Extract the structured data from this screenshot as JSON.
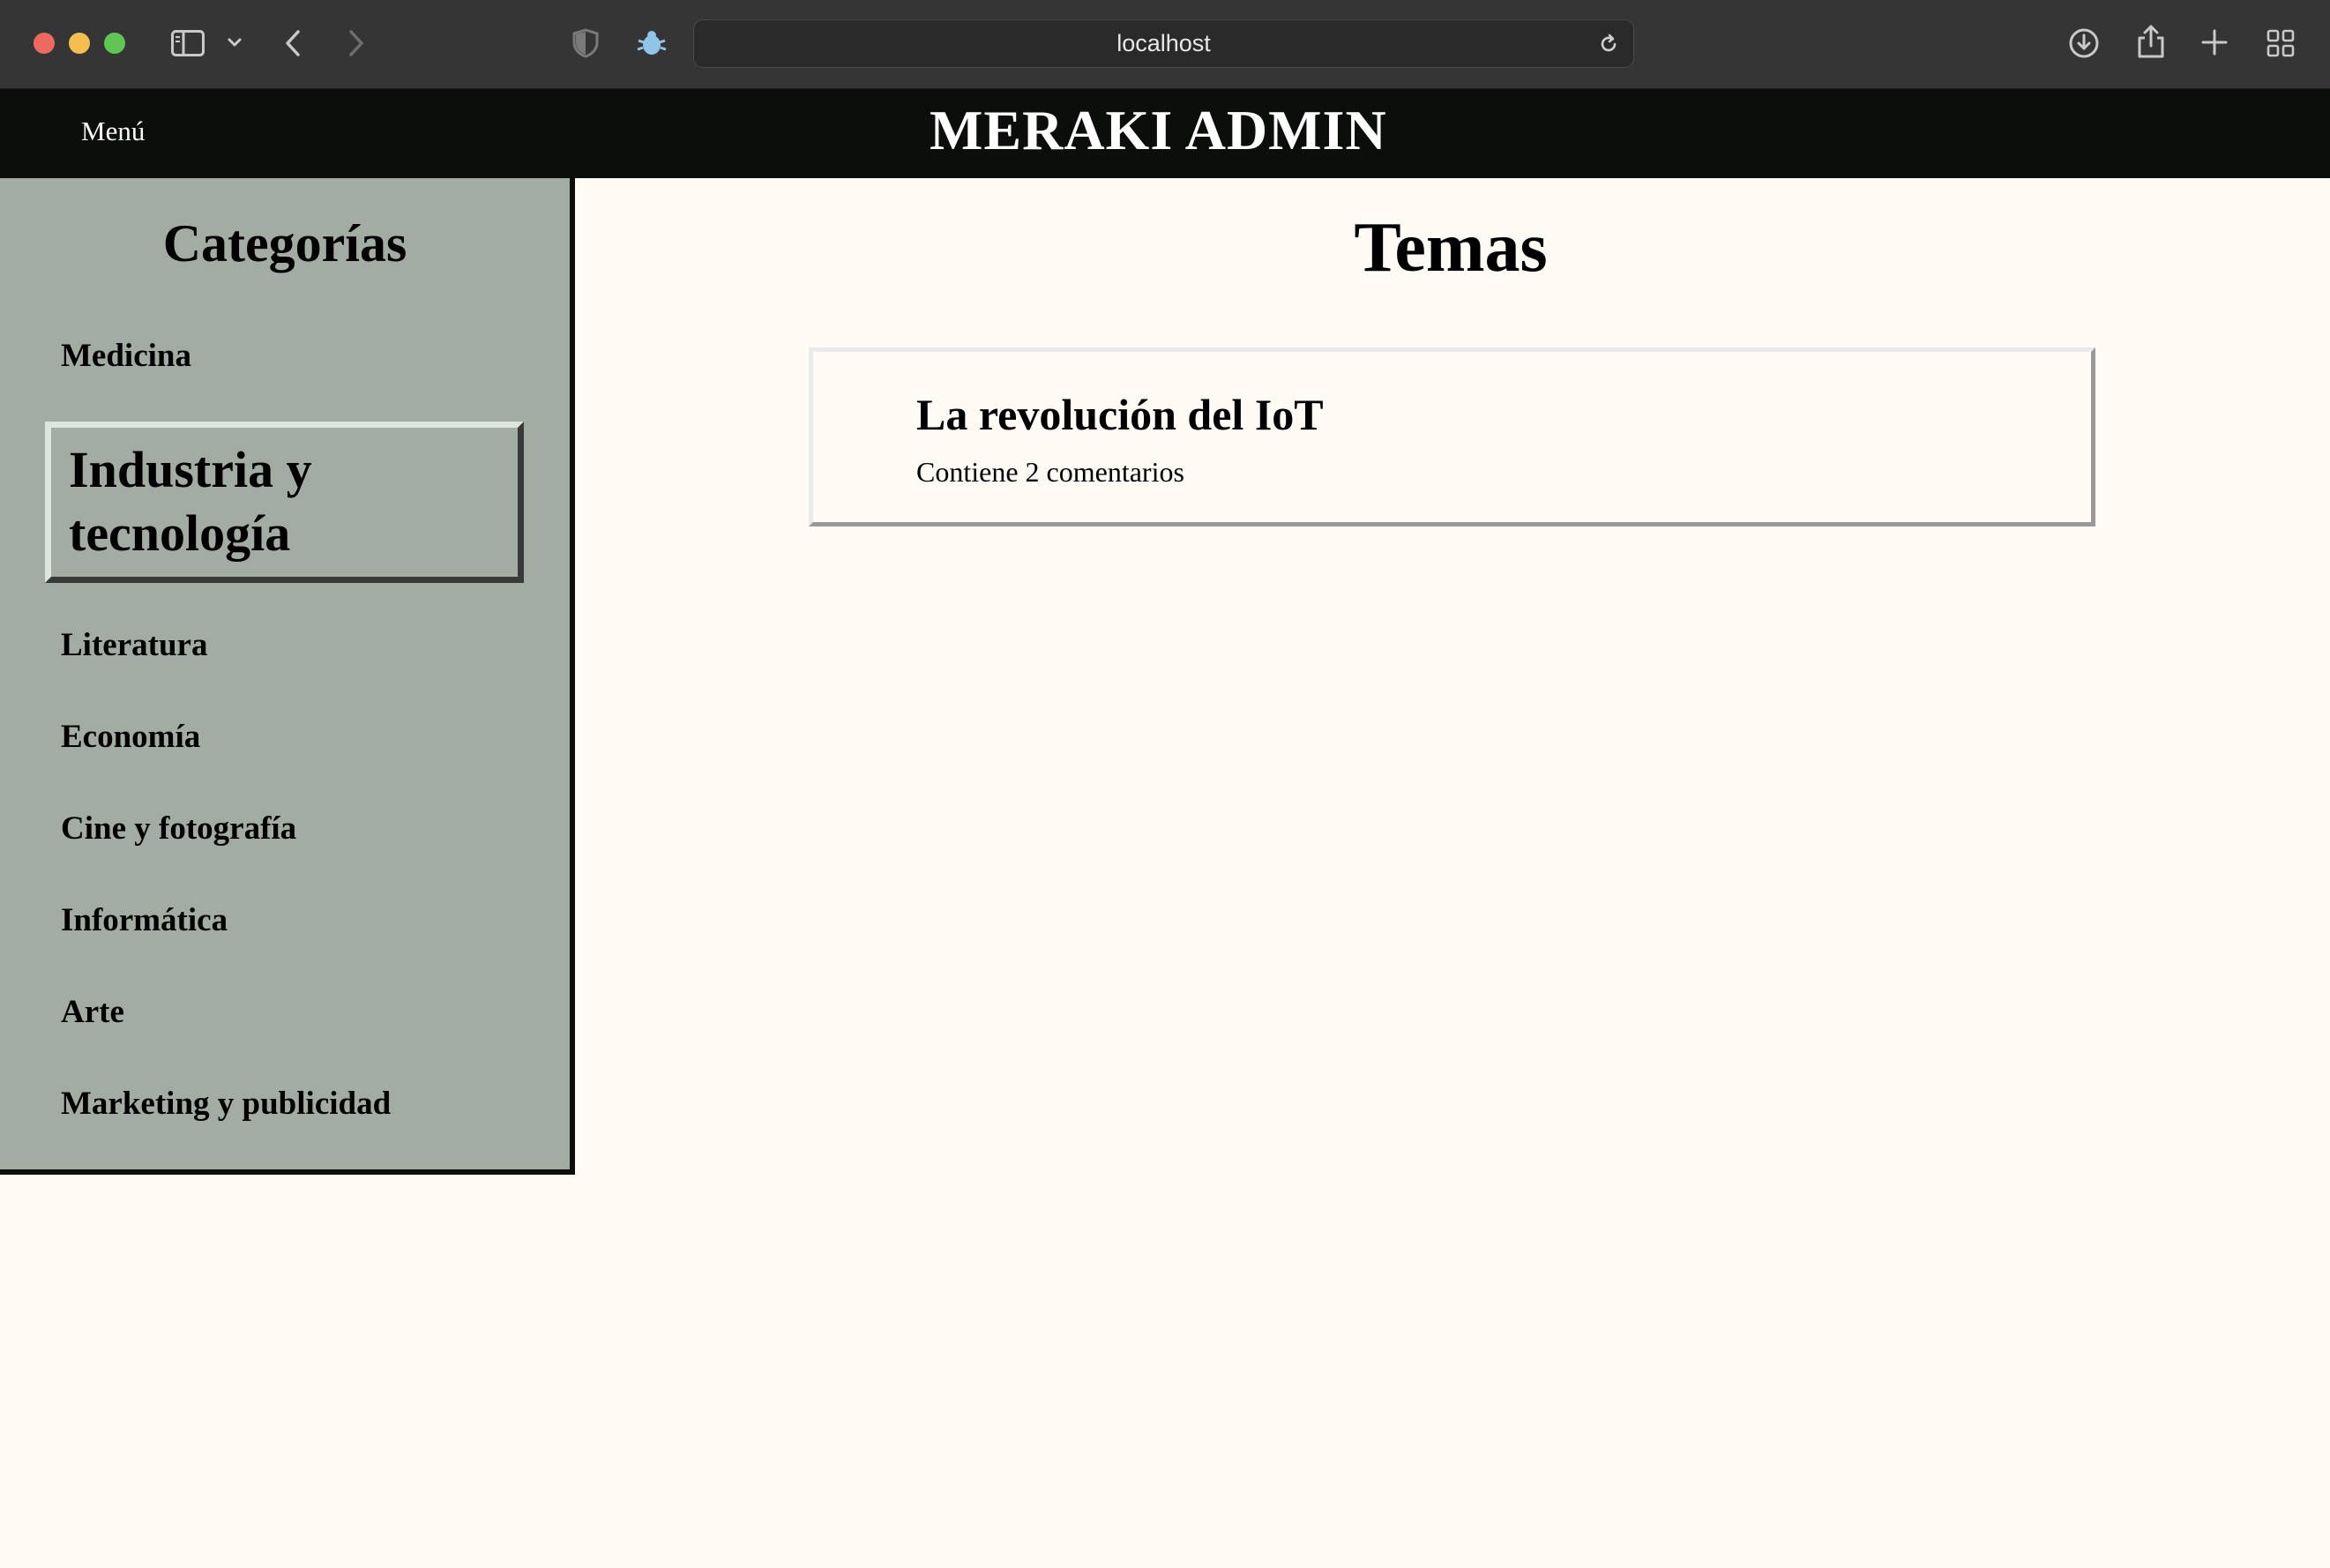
{
  "browser": {
    "url": "localhost",
    "icons": [
      "sidebar-toggle-icon",
      "chevron-down-icon",
      "back-arrow-icon",
      "forward-arrow-icon",
      "shield-icon",
      "extension-bug-icon",
      "reload-icon",
      "download-icon",
      "share-icon",
      "new-tab-plus-icon",
      "tab-overview-icon"
    ]
  },
  "header": {
    "menu_label": "Menú",
    "title": "MERAKI ADMIN",
    "background": "#0c0e0b"
  },
  "sidebar": {
    "title": "Categorías",
    "background": "#a2aca3",
    "items": [
      {
        "label": "Medicina",
        "active": false
      },
      {
        "label": "Industria y tecnología",
        "active": true
      },
      {
        "label": "Literatura",
        "active": false
      },
      {
        "label": "Economía",
        "active": false
      },
      {
        "label": "Cine y fotografía",
        "active": false
      },
      {
        "label": "Informática",
        "active": false
      },
      {
        "label": "Arte",
        "active": false
      },
      {
        "label": "Marketing y publicidad",
        "active": false
      }
    ]
  },
  "main": {
    "title": "Temas",
    "topics": [
      {
        "title": "La revolución del IoT",
        "meta": "Contiene 2 comentarios"
      }
    ]
  }
}
